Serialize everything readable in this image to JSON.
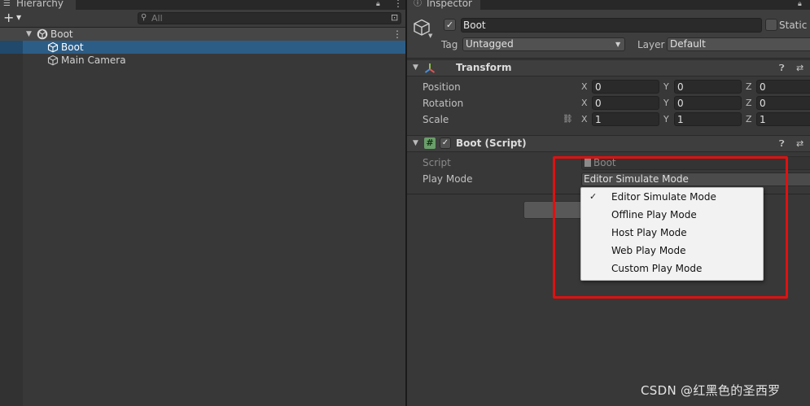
{
  "hierarchy": {
    "tab_label": "Hierarchy",
    "search_placeholder": "All",
    "scene_name": "Boot",
    "items": [
      {
        "label": "Boot",
        "selected": true
      },
      {
        "label": "Main Camera",
        "selected": false
      }
    ]
  },
  "inspector": {
    "tab_label": "Inspector",
    "gameobject": {
      "active": true,
      "name": "Boot",
      "static_label": "Static",
      "static_checked": false,
      "tag_label": "Tag",
      "tag_value": "Untagged",
      "layer_label": "Layer",
      "layer_value": "Default"
    },
    "transform": {
      "title": "Transform",
      "position_label": "Position",
      "rotation_label": "Rotation",
      "scale_label": "Scale",
      "axis_x": "X",
      "axis_y": "Y",
      "axis_z": "Z",
      "position": [
        "0",
        "0",
        "0"
      ],
      "rotation": [
        "0",
        "0",
        "0"
      ],
      "scale": [
        "1",
        "1",
        "1"
      ]
    },
    "script_component": {
      "title": "Boot (Script)",
      "enabled": true,
      "script_label": "Script",
      "script_value": "Boot",
      "playmode_label": "Play Mode",
      "playmode_value": "Editor Simulate Mode"
    }
  },
  "dropdown": {
    "options": [
      {
        "label": "Editor Simulate Mode",
        "checked": true
      },
      {
        "label": "Offline Play Mode",
        "checked": false
      },
      {
        "label": "Host Play Mode",
        "checked": false
      },
      {
        "label": "Web Play Mode",
        "checked": false
      },
      {
        "label": "Custom Play Mode",
        "checked": false
      }
    ],
    "check_glyph": "✓"
  },
  "watermark": "CSDN @红黑色的圣西罗",
  "colors": {
    "selection": "#2c5d87",
    "highlight_box": "#e01010",
    "panel_bg": "#383838"
  },
  "icons": [
    "hierarchy-list-icon",
    "lock-icon",
    "more-icon",
    "plus-icon",
    "search-icon",
    "unity-scene-icon",
    "gameobject-cube-icon",
    "transform-axes-icon",
    "script-hash-icon",
    "help-icon",
    "presets-icon",
    "link-icon",
    "checkmark-icon"
  ]
}
